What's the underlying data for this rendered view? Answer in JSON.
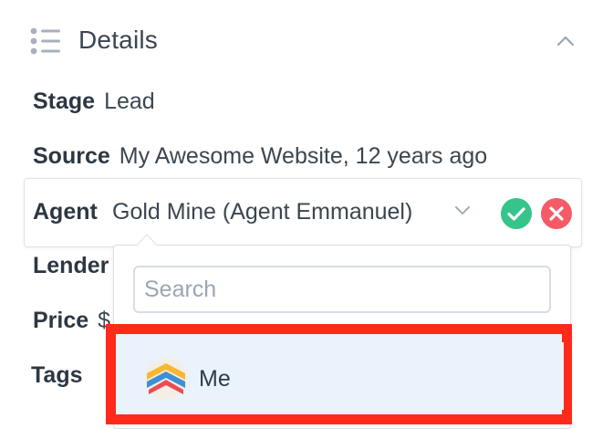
{
  "section": {
    "title": "Details",
    "icons": {
      "list": "list-icon",
      "collapse": "chevron-up-icon"
    }
  },
  "fields": {
    "stage": {
      "label": "Stage",
      "value": "Lead"
    },
    "source": {
      "label": "Source",
      "value": "My Awesome Website, 12 years ago"
    },
    "lender": {
      "label": "Lender"
    },
    "price": {
      "label": "Price",
      "value": "$"
    },
    "tags": {
      "label": "Tags"
    }
  },
  "agent_editor": {
    "label": "Agent",
    "selected_value": "Gold Mine (Agent Emmanuel)",
    "icons": {
      "dropdown": "chevron-down-icon",
      "confirm": "check-icon",
      "cancel": "close-icon"
    },
    "colors": {
      "confirm": "#35c48a",
      "cancel": "#f45b66"
    }
  },
  "dropdown": {
    "search_placeholder": "Search",
    "search_value": "",
    "options": [
      {
        "label": "Me",
        "icon": "brand-logo-icon"
      }
    ]
  },
  "annotation": {
    "highlight_color": "#ff2a1a"
  }
}
